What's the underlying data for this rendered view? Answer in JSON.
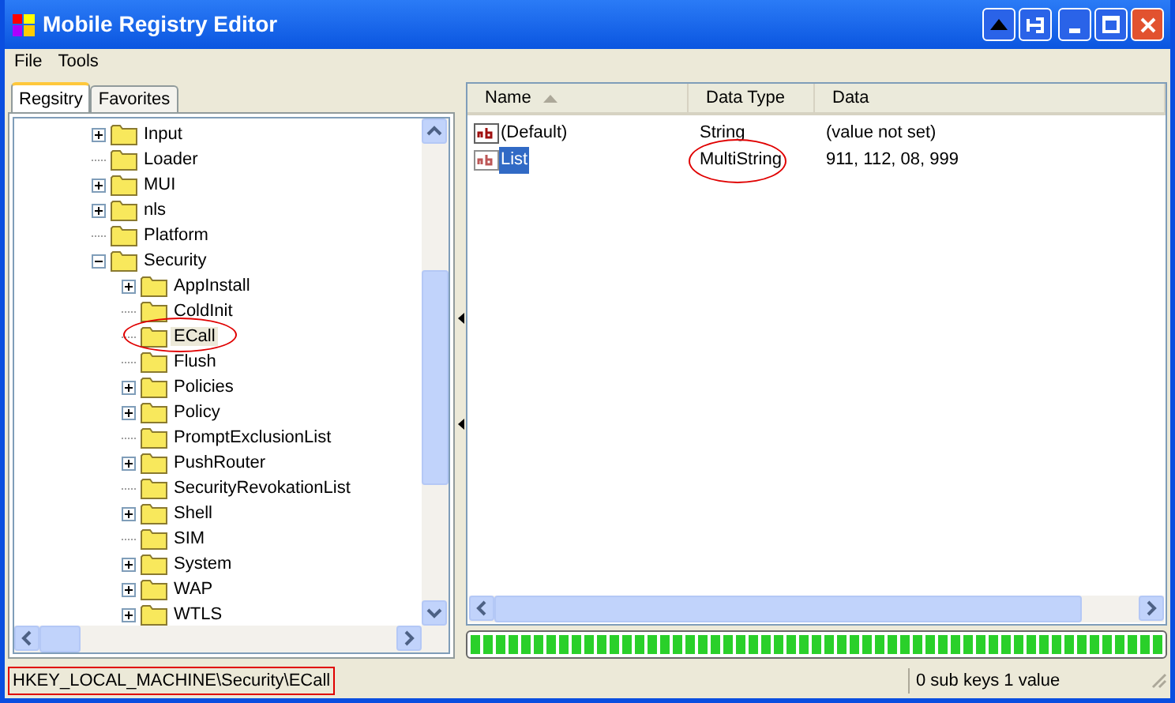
{
  "window": {
    "title": "Mobile Registry Editor"
  },
  "menu": [
    "File",
    "Tools"
  ],
  "tabs": [
    {
      "label": "Regsitry",
      "selected": true
    },
    {
      "label": "Favorites",
      "selected": false
    }
  ],
  "tree": [
    {
      "label": "Input",
      "kind": "branch",
      "expanded": false,
      "selected": false,
      "circled": false
    },
    {
      "label": "Loader",
      "kind": "leaf",
      "selected": false,
      "circled": false
    },
    {
      "label": "MUI",
      "kind": "branch",
      "expanded": false,
      "selected": false,
      "circled": false
    },
    {
      "label": "nls",
      "kind": "branch",
      "expanded": false,
      "selected": false,
      "circled": false
    },
    {
      "label": "Platform",
      "kind": "leaf",
      "selected": false,
      "circled": false
    },
    {
      "label": "Security",
      "kind": "branch",
      "expanded": true,
      "selected": false,
      "circled": false,
      "children": [
        {
          "label": "AppInstall",
          "kind": "branch",
          "expanded": false,
          "selected": false,
          "circled": false
        },
        {
          "label": "ColdInit",
          "kind": "leaf",
          "selected": false,
          "circled": false
        },
        {
          "label": "ECall",
          "kind": "leaf",
          "selected": true,
          "circled": true
        },
        {
          "label": "Flush",
          "kind": "leaf",
          "selected": false,
          "circled": false
        },
        {
          "label": "Policies",
          "kind": "branch",
          "expanded": false,
          "selected": false,
          "circled": false
        },
        {
          "label": "Policy",
          "kind": "branch",
          "expanded": false,
          "selected": false,
          "circled": false
        },
        {
          "label": "PromptExclusionList",
          "kind": "leaf",
          "selected": false,
          "circled": false
        },
        {
          "label": "PushRouter",
          "kind": "branch",
          "expanded": false,
          "selected": false,
          "circled": false
        },
        {
          "label": "SecurityRevokationList",
          "kind": "leaf",
          "selected": false,
          "circled": false
        },
        {
          "label": "Shell",
          "kind": "branch",
          "expanded": false,
          "selected": false,
          "circled": false
        },
        {
          "label": "SIM",
          "kind": "leaf",
          "selected": false,
          "circled": false
        },
        {
          "label": "System",
          "kind": "branch",
          "expanded": false,
          "selected": false,
          "circled": false
        },
        {
          "label": "WAP",
          "kind": "branch",
          "expanded": false,
          "selected": false,
          "circled": false
        },
        {
          "label": "WTLS",
          "kind": "branch",
          "expanded": false,
          "selected": false,
          "circled": false
        }
      ]
    }
  ],
  "list": {
    "columns": [
      "Name",
      "Data Type",
      "Data"
    ],
    "rows": [
      {
        "name": "(Default)",
        "type": "String",
        "data": "(value not set)",
        "selected": false,
        "type_circled": false
      },
      {
        "name": "List",
        "type": "MultiString",
        "data": "911, 112, 08, 999",
        "selected": true,
        "type_circled": true
      }
    ]
  },
  "progress": {
    "level": 1
  },
  "status_bar": {
    "path": "HKEY_LOCAL_MACHINE\\Security\\ECall",
    "path_circled": true,
    "summary": "0 sub keys 1 value"
  }
}
